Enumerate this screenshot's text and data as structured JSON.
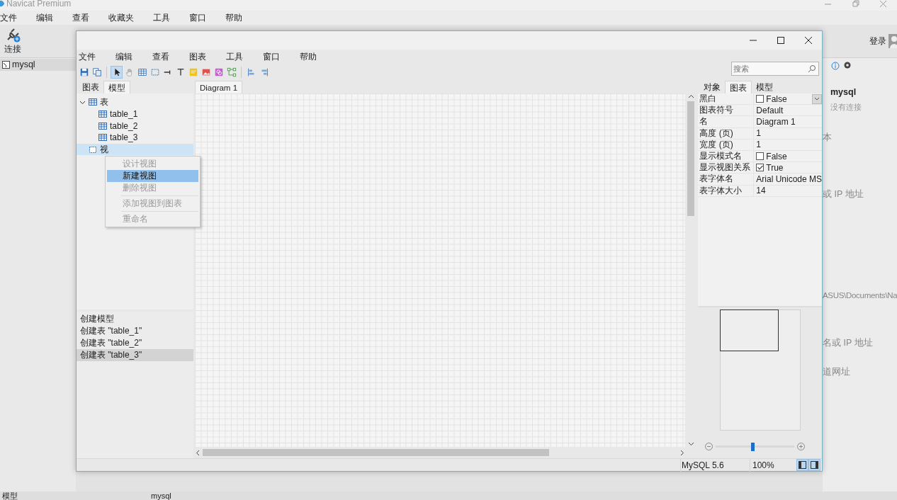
{
  "desktop_app": {
    "title": "Navicat Premium",
    "menu": [
      "文件",
      "编辑",
      "查看",
      "收藏夹",
      "工具",
      "窗口",
      "帮助"
    ],
    "connect_button": "连接",
    "login": "登录",
    "connections": [
      {
        "label": "mysql",
        "selected": true
      }
    ],
    "info": {
      "name": "mysql",
      "status": "没有连接",
      "fragments": [
        "本",
        "或 IP 地址",
        "ASUS\\Documents\\Na",
        "名或 IP 地址",
        "道网址"
      ]
    },
    "status_bar": [
      "模型",
      "mysql"
    ]
  },
  "window": {
    "menu": [
      "文件",
      "编辑",
      "查看",
      "图表",
      "工具",
      "窗口",
      "帮助"
    ],
    "tools": [
      {
        "kind": "save",
        "selected": false
      },
      {
        "kind": "copy",
        "selected": false
      },
      {
        "kind": "pointer",
        "selected": true
      },
      {
        "kind": "hand",
        "selected": false
      },
      {
        "kind": "table",
        "selected": false
      },
      {
        "kind": "view",
        "selected": false
      },
      {
        "kind": "line",
        "selected": false
      },
      {
        "kind": "text",
        "selected": false
      },
      {
        "kind": "note",
        "selected": false
      },
      {
        "kind": "image",
        "selected": false
      },
      {
        "kind": "layer",
        "selected": false
      },
      {
        "kind": "relation",
        "selected": false
      },
      {
        "kind": "align-left",
        "selected": false
      },
      {
        "kind": "align-right",
        "selected": false
      }
    ],
    "search": {
      "placeholder": "搜索"
    },
    "left_tabs": [
      {
        "label": "图表",
        "selected": false
      },
      {
        "label": "模型",
        "selected": true
      }
    ],
    "tree": [
      {
        "label": "表",
        "kind": "tables",
        "expanded": true,
        "selected": false,
        "children": [
          {
            "label": "table_1",
            "kind": "table",
            "selected": false
          },
          {
            "label": "table_2",
            "kind": "table",
            "selected": false
          },
          {
            "label": "table_3",
            "kind": "table",
            "selected": false
          }
        ]
      },
      {
        "label": "视",
        "kind": "views",
        "selected": true
      }
    ],
    "context_menu": [
      {
        "label": "设计视图",
        "disabled": true,
        "selected": false,
        "separator_before": false
      },
      {
        "label": "新建视图",
        "disabled": false,
        "selected": true,
        "separator_before": false
      },
      {
        "label": "删除视图",
        "disabled": true,
        "selected": false,
        "separator_before": false
      },
      {
        "label": "添加视图到图表",
        "disabled": true,
        "selected": false,
        "separator_before": true
      },
      {
        "label": "重命名",
        "disabled": true,
        "selected": false,
        "separator_before": true
      }
    ],
    "history": [
      {
        "label": "创建模型",
        "selected": false
      },
      {
        "label": "创建表 \"table_1\"",
        "selected": false
      },
      {
        "label": "创建表 \"table_2\"",
        "selected": false
      },
      {
        "label": "创建表 \"table_3\"",
        "selected": true
      }
    ],
    "diagram_tabs": [
      {
        "label": "Diagram 1",
        "selected": true
      }
    ],
    "right_tabs": [
      {
        "label": "对象",
        "selected": false
      },
      {
        "label": "图表",
        "selected": true
      },
      {
        "label": "模型",
        "selected": false
      }
    ],
    "properties": [
      {
        "name": "黑白",
        "value": "False",
        "kind": "checkbox",
        "checked": false,
        "editing": true
      },
      {
        "name": "图表符号",
        "value": "Default",
        "kind": "text",
        "editing": false
      },
      {
        "name": "名",
        "value": "Diagram 1",
        "kind": "text",
        "editing": false
      },
      {
        "name": "高度 (页)",
        "value": "1",
        "kind": "text",
        "editing": false
      },
      {
        "name": "宽度 (页)",
        "value": "1",
        "kind": "text",
        "editing": false
      },
      {
        "name": "显示模式名",
        "value": "False",
        "kind": "checkbox",
        "checked": false,
        "editing": false
      },
      {
        "name": "显示视图关系",
        "value": "True",
        "kind": "checkbox",
        "checked": true,
        "editing": false
      },
      {
        "name": "表字体名",
        "value": "Arial Unicode MS",
        "kind": "text",
        "editing": false
      },
      {
        "name": "表字体大小",
        "value": "14",
        "kind": "text",
        "editing": false
      }
    ],
    "zoom": {
      "level": 0.47
    },
    "status_bar": {
      "server": "MySQL 5.6",
      "zoom": "100%",
      "panels": [
        {
          "kind": "left",
          "selected": true
        },
        {
          "kind": "right",
          "selected": true
        }
      ]
    }
  }
}
